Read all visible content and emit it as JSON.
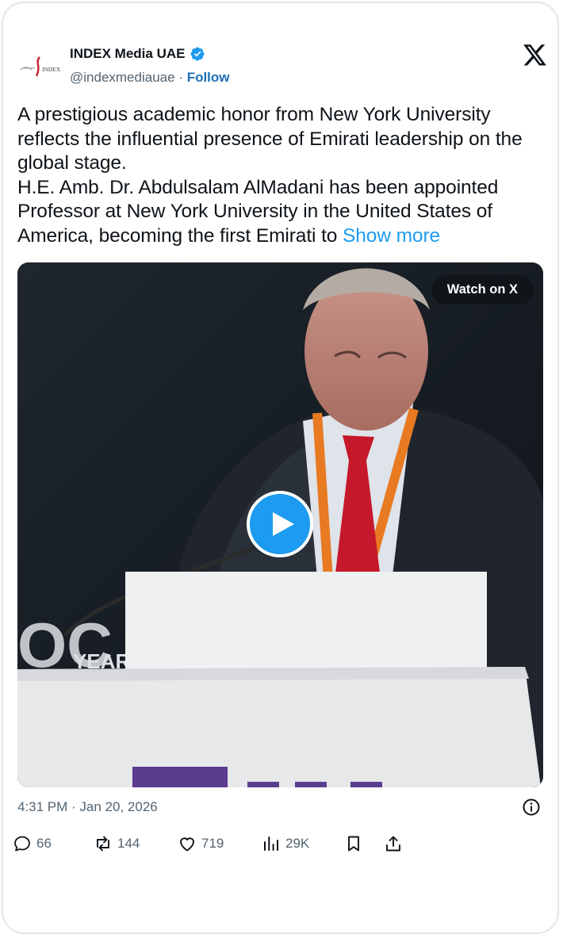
{
  "account": {
    "name": "INDEX Media UAE",
    "handle": "@indexmediauae",
    "separator": " · ",
    "follow_label": "Follow",
    "avatar_logo_text": "INDEX",
    "verified": true
  },
  "tweet": {
    "text": "A prestigious academic honor from New York University reflects the influential presence of Emirati leadership on the global stage.\nH.E. Amb. Dr. Abdulsalam AlMadani has been appointed Professor at New York University in the United States of America, becoming the first Emirati to ",
    "show_more_label": "Show more"
  },
  "media": {
    "watch_label": "Watch on X",
    "background_text": "YEAR"
  },
  "meta": {
    "timestamp": "4:31 PM · Jan 20, 2026"
  },
  "actions": {
    "replies": "66",
    "reposts": "144",
    "likes": "719",
    "views": "29K"
  },
  "colors": {
    "accent": "#1d9bf0",
    "follow": "#1d6fb8",
    "text": "#0f1419",
    "muted": "#536471",
    "border": "#e3e7ea"
  },
  "icons": [
    "x-logo-icon",
    "verified-badge-icon",
    "play-icon",
    "info-icon",
    "reply-icon",
    "repost-icon",
    "like-icon",
    "views-icon",
    "bookmark-icon",
    "share-icon"
  ]
}
